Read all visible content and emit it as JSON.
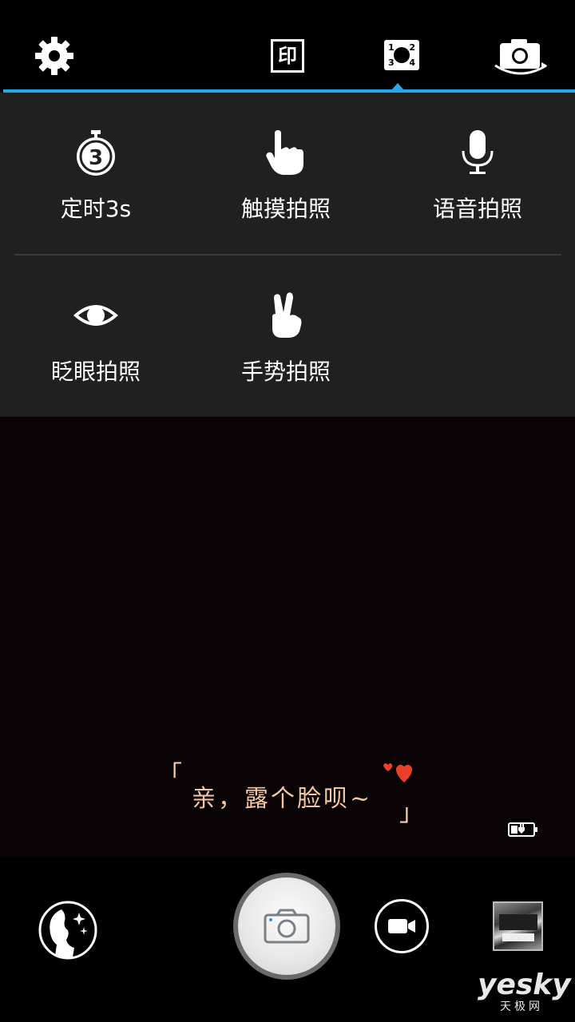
{
  "top_bar": {
    "settings_icon": "gear-icon",
    "print_icon_text": "印",
    "multi_shot_icon": [
      "1",
      "2",
      "3",
      "4"
    ],
    "switch_camera_icon": "camera-switch-icon",
    "accent_color": "#2ba6e8"
  },
  "modes": {
    "items": [
      {
        "label": "定时3s",
        "icon": "timer-icon",
        "icon_text": "3"
      },
      {
        "label": "触摸拍照",
        "icon": "touch-icon"
      },
      {
        "label": "语音拍照",
        "icon": "microphone-icon"
      },
      {
        "label": "眨眼拍照",
        "icon": "eye-icon"
      },
      {
        "label": "手势拍照",
        "icon": "victory-hand-icon"
      }
    ]
  },
  "viewfinder": {
    "hint_text": "亲，露个脸呗~",
    "hint_color": "#f3c89f",
    "heart_color": "#e8402b"
  },
  "bottom_bar": {
    "beauty_icon": "beauty-face-icon",
    "shutter_icon": "camera-icon",
    "video_icon": "video-camera-icon",
    "gallery_icon": "gallery-thumbnail"
  },
  "watermark": {
    "main": "yesky",
    "sub": "天极网"
  }
}
